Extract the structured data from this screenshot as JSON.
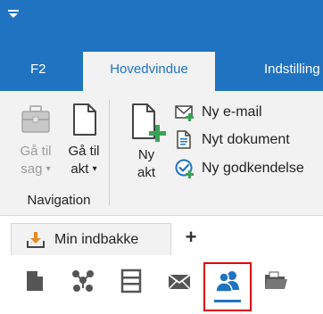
{
  "titlebar": {
    "quick_access_icon": "chevron-down-icon",
    "color": "#1f73c1"
  },
  "tabs": [
    {
      "label": "F2"
    },
    {
      "label": "Hovedvindue",
      "active": true
    },
    {
      "label": "Indstilling"
    }
  ],
  "ribbon": {
    "navigation": {
      "group_label": "Navigation",
      "buttons": [
        {
          "line1": "Gå til",
          "line2": "sag",
          "icon": "briefcase-icon",
          "enabled": false,
          "has_dropdown": true
        },
        {
          "line1": "Gå til",
          "line2": "akt",
          "icon": "document-icon",
          "enabled": true,
          "has_dropdown": true
        }
      ]
    },
    "new_act": {
      "line1": "Ny",
      "line2": "akt",
      "icon": "new-document-icon"
    },
    "small_buttons": [
      {
        "label": "Ny e-mail",
        "icon": "envelope-plus-icon"
      },
      {
        "label": "Nyt dokument",
        "icon": "new-file-icon"
      },
      {
        "label": "Ny godkendelse",
        "icon": "approval-icon"
      }
    ]
  },
  "doc_tabs": {
    "active_tab": {
      "label": "Min indbakke",
      "icon": "inbox-tray-icon"
    },
    "add_symbol": "+"
  },
  "iconbar": {
    "items": [
      {
        "icon": "document-icon"
      },
      {
        "icon": "org-chart-icon"
      },
      {
        "icon": "archive-cabinet-icon"
      },
      {
        "icon": "mail-icon"
      },
      {
        "icon": "users-icon",
        "selected": true
      },
      {
        "icon": "folder-icon"
      }
    ],
    "accent": "#1f73c1",
    "highlight": "#e00000"
  }
}
